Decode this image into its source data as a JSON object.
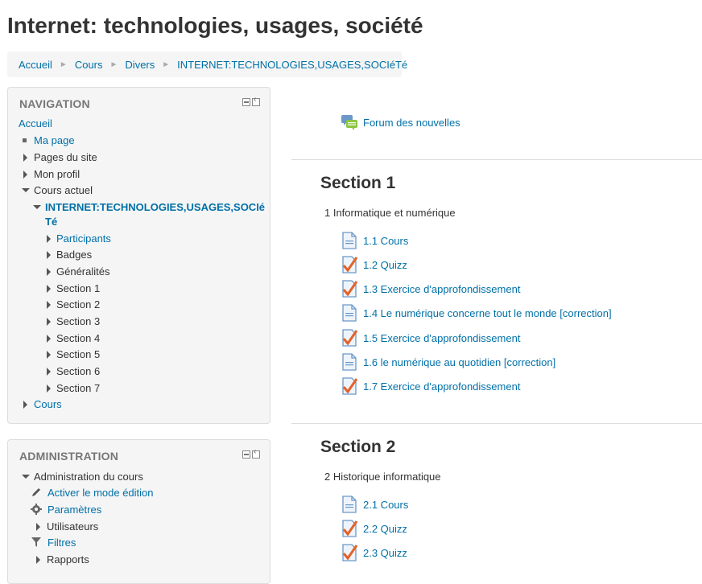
{
  "page": {
    "title": "Internet: technologies, usages, société"
  },
  "breadcrumb": [
    "Accueil",
    "Cours",
    "Divers",
    "INTERNET:TECHNOLOGIES,USAGES,SOCIéTé"
  ],
  "navigation": {
    "header": "NAVIGATION",
    "home": "Accueil",
    "my_page": "Ma page",
    "site_pages": "Pages du site",
    "my_profile": "Mon profil",
    "current_course": "Cours actuel",
    "course_name_line1": "INTERNET:TECHNOLOGIES,USAGES,SOCIé",
    "course_name_line2": "Té",
    "participants": "Participants",
    "badges": "Badges",
    "generalities": "Généralités",
    "sections": [
      "Section 1",
      "Section 2",
      "Section 3",
      "Section 4",
      "Section 5",
      "Section 6",
      "Section 7"
    ],
    "courses": "Cours"
  },
  "administration": {
    "header": "ADMINISTRATION",
    "course_admin": "Administration du cours",
    "edit_mode": "Activer le mode édition",
    "settings": "Paramètres",
    "users": "Utilisateurs",
    "filters": "Filtres",
    "reports": "Rapports"
  },
  "forum": {
    "label": "Forum des nouvelles",
    "icon": "forum-icon"
  },
  "sections": [
    {
      "title": "Section 1",
      "summary": "1 Informatique et numérique",
      "activities": [
        {
          "label": "1.1 Cours",
          "icon": "page-icon"
        },
        {
          "label": "1.2 Quizz",
          "icon": "quiz-icon"
        },
        {
          "label": "1.3 Exercice d'approfondissement",
          "icon": "quiz-icon"
        },
        {
          "label": "1.4 Le numérique concerne tout le monde [correction]",
          "icon": "page-icon"
        },
        {
          "label": "1.5 Exercice d'approfondissement",
          "icon": "quiz-icon"
        },
        {
          "label": "1.6 le numérique au quotidien [correction]",
          "icon": "page-icon"
        },
        {
          "label": "1.7 Exercice d'approfondissement",
          "icon": "quiz-icon"
        }
      ]
    },
    {
      "title": "Section 2",
      "summary": "2 Historique informatique",
      "activities": [
        {
          "label": "2.1 Cours",
          "icon": "page-icon"
        },
        {
          "label": "2.2 Quizz",
          "icon": "quiz-icon"
        },
        {
          "label": "2.3 Quizz",
          "icon": "quiz-icon"
        }
      ]
    }
  ],
  "colors": {
    "link": "#0070a8",
    "block_bg": "#f5f5f5",
    "header_grey": "#777777",
    "quiz_check": "#e2622a",
    "page_icon_blue": "#6b97c9"
  }
}
